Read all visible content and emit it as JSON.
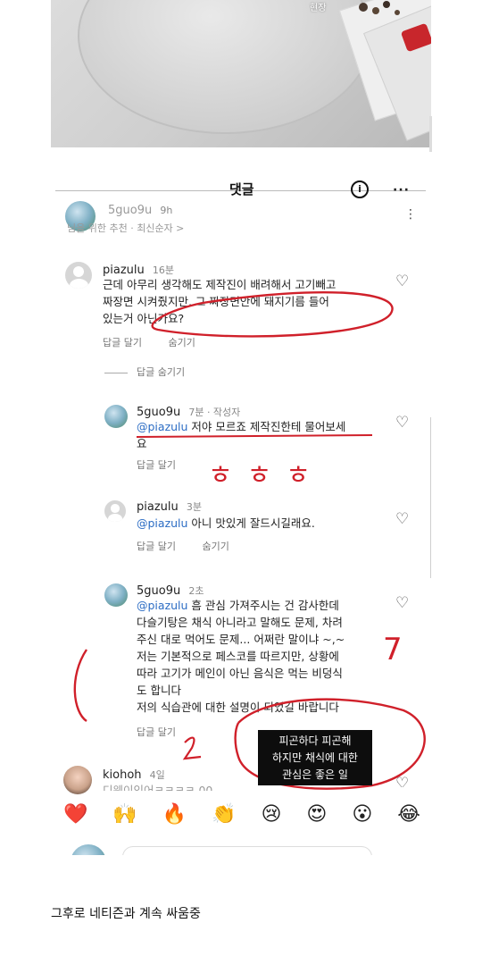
{
  "top_photo": {
    "caption": "현장"
  },
  "sheet": {
    "title": "댓글"
  },
  "post": {
    "username": "5guo9u",
    "time": "9h",
    "sub": "님을 위한 추천 · 최신순자 >"
  },
  "comments": [
    {
      "username": "piazulu",
      "time": "16분",
      "lines": [
        "근데 아무리 생각해도 제작진이 배려해서 고기빼고",
        "짜장면 시켜줬지만, 그 짜장면안에 돼지기름 들어",
        "있는거 아닌가요?"
      ],
      "reply": "답글 달기",
      "hide": "숨기기"
    },
    {
      "hide_replies": "답글 숨기기"
    },
    {
      "username": "5guo9u",
      "time": "7분 · 작성자",
      "mention": "@piazulu",
      "lines": [
        " 저야 모르죠 제작진한테 물어보세",
        "요"
      ],
      "reply": "답글 달기"
    },
    {
      "username": "piazulu",
      "time": "3분",
      "mention": "@piazulu",
      "lines": [
        " 아니 맛있게 잘드시길래요."
      ],
      "reply": "답글 달기",
      "hide": "숨기기"
    },
    {
      "username": "5guo9u",
      "time": "2초",
      "mention": "@piazulu",
      "lines": [
        " 흠 관심 가져주시는 건 감사한데",
        "다슬기탕은 채식 아니라고 말해도 문제, 차려",
        "주신 대로 먹어도 문제... 어쩌란 말이냐 ~,~",
        "저는 기본적으로 페스코를 따르지만, 상황에",
        "따라 고기가 메인이 아닌 음식은 먹는 비덩식",
        "도 합니다",
        "저의 식습관에 대한 설명이 되었길 바랍니다"
      ],
      "reply": "답글 달기"
    },
    {
      "username": "kiohoh",
      "time": "4일",
      "lines": [
        "디웨이인어ㅋㅋㅋㅋ 00"
      ]
    }
  ],
  "annotations": {
    "red_text": "ㅎㅎㅎ",
    "seven": "7",
    "overlay": [
      "피곤하다 피곤해",
      "하지만 채식에 대한",
      "관심은 좋은 일"
    ]
  },
  "emoji_bar": [
    "❤️",
    "🙌",
    "🔥",
    "👏",
    "😢",
    "😍",
    "😮",
    "😂"
  ],
  "bottom_caption": "그후로 네티즌과 계속 싸움중",
  "colors": {
    "accent_red": "#d0202a",
    "mention_blue": "#2b6cc4"
  }
}
